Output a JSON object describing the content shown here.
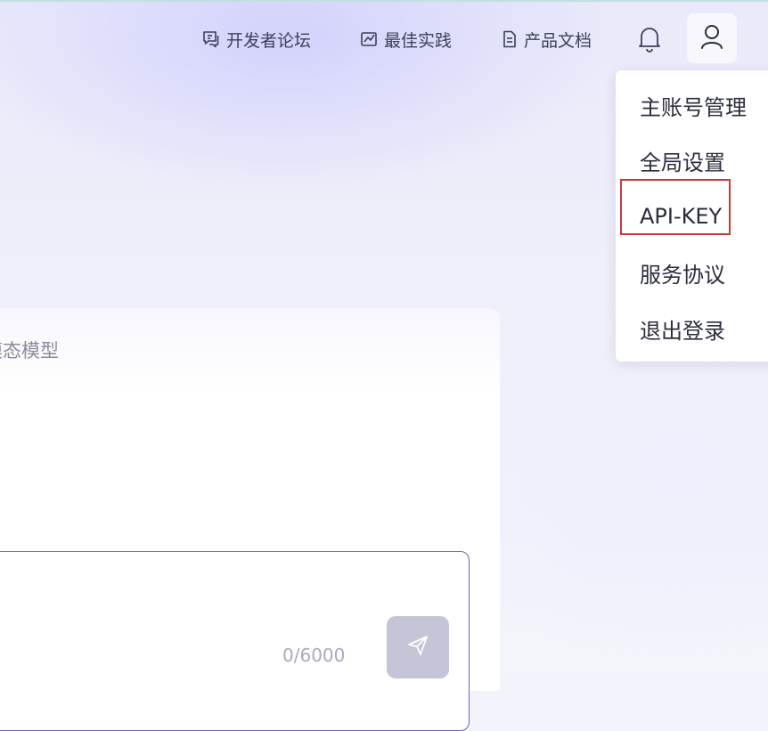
{
  "header": {
    "nav": [
      {
        "label": "开发者论坛",
        "icon": "chat-square-icon"
      },
      {
        "label": "最佳实践",
        "icon": "image-frame-icon"
      },
      {
        "label": "产品文档",
        "icon": "document-icon"
      }
    ],
    "notification_icon": "bell-icon",
    "user_icon": "user-icon"
  },
  "user_menu": {
    "items": [
      {
        "label": "主账号管理"
      },
      {
        "label": "全局设置"
      },
      {
        "label": "API-KEY",
        "highlighted": true
      },
      {
        "label": "服务协议"
      },
      {
        "label": "退出登录"
      }
    ],
    "highlight_color": "#c73a3a"
  },
  "chat": {
    "title_fragment": "模态模型",
    "char_count": "0/6000",
    "send_icon": "send-plane-icon"
  },
  "colors": {
    "accent": "#6f5fc6",
    "text_dark": "#2b2d3e",
    "send_disabled": "#c4c5d6"
  }
}
